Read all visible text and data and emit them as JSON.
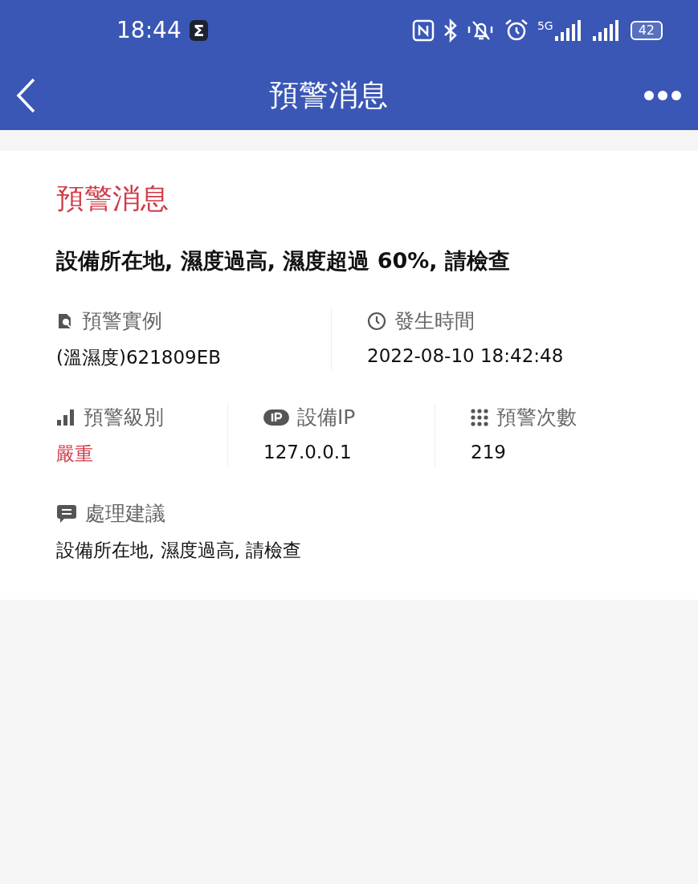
{
  "status_bar": {
    "time": "18:44",
    "badge": "Σ",
    "network": "5G",
    "battery": "42"
  },
  "nav": {
    "title": "預警消息"
  },
  "card": {
    "title": "預警消息",
    "headline": "設備所在地, 濕度過高, 濕度超過 60%, 請檢查",
    "instance": {
      "label": "預警實例",
      "value": "(溫濕度)621809EB"
    },
    "time": {
      "label": "發生時間",
      "value": "2022-08-10 18:42:48"
    },
    "level": {
      "label": "預警級別",
      "value": "嚴重",
      "highlight": true
    },
    "ip": {
      "label": "設備IP",
      "value": "127.0.0.1"
    },
    "count": {
      "label": "預警次數",
      "value": "219"
    },
    "advice": {
      "label": "處理建議",
      "value": "設備所在地, 濕度過高, 請檢查"
    }
  }
}
